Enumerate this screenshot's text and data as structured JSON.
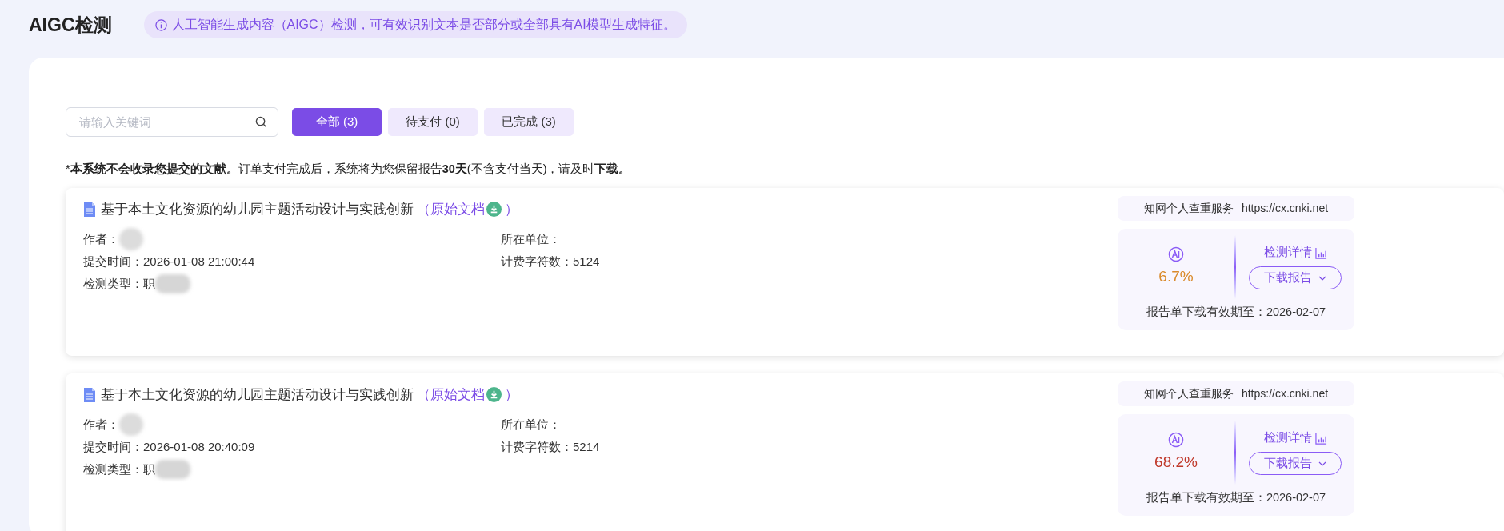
{
  "page_title": "AIGC检测",
  "notice_banner": "人工智能生成内容（AIGC）检测，可有效识别文本是否部分或全部具有AI模型生成特征。",
  "search": {
    "placeholder": "请输入关键词"
  },
  "tabs": [
    {
      "label": "全部 (3)",
      "selected": true
    },
    {
      "label": "待支付 (0)",
      "selected": false
    },
    {
      "label": "已完成 (3)",
      "selected": false
    }
  ],
  "disclaimer": [
    {
      "text": "*",
      "bold": false
    },
    {
      "text": "本系统不会收录您提交的文献。",
      "bold": true
    },
    {
      "text": "订单支付完成后，系统将为您保留报告",
      "bold": false
    },
    {
      "text": "30天",
      "bold": true
    },
    {
      "text": "(不含支付当天)，请及时",
      "bold": false
    },
    {
      "text": "下载。",
      "bold": true
    }
  ],
  "records": [
    {
      "title": "基于本土文化资源的幼儿园主题活动设计与实践创新",
      "original_link": "（原始文档",
      "link_close": "）",
      "author_label": "作者：",
      "submitted": "提交时间：2026-01-08 21:00:44",
      "check_type": "检测类型：职",
      "organization": "所在单位：",
      "billed_chars": "计费字符数：5124",
      "service_name": "知网个人查重服务",
      "service_url": "https://cx.cnki.net",
      "ai_score": "6.7%",
      "color": "#d98a2b",
      "details_link": "检测详情",
      "download_button": "下载报告",
      "validity": "报告单下载有效期至：2026-02-07"
    },
    {
      "title": "基于本土文化资源的幼儿园主题活动设计与实践创新",
      "original_link": "（原始文档",
      "link_close": "）",
      "author_label": "作者：",
      "submitted": "提交时间：2026-01-08 20:40:09",
      "check_type": "检测类型：职",
      "organization": "所在单位：",
      "billed_chars": "计费字符数：5214",
      "service_name": "知网个人查重服务",
      "service_url": "https://cx.cnki.net",
      "ai_score": "68.2%",
      "color": "#c0392b",
      "details_link": "检测详情",
      "download_button": "下载报告",
      "validity": "报告单下载有效期至：2026-02-07"
    }
  ]
}
